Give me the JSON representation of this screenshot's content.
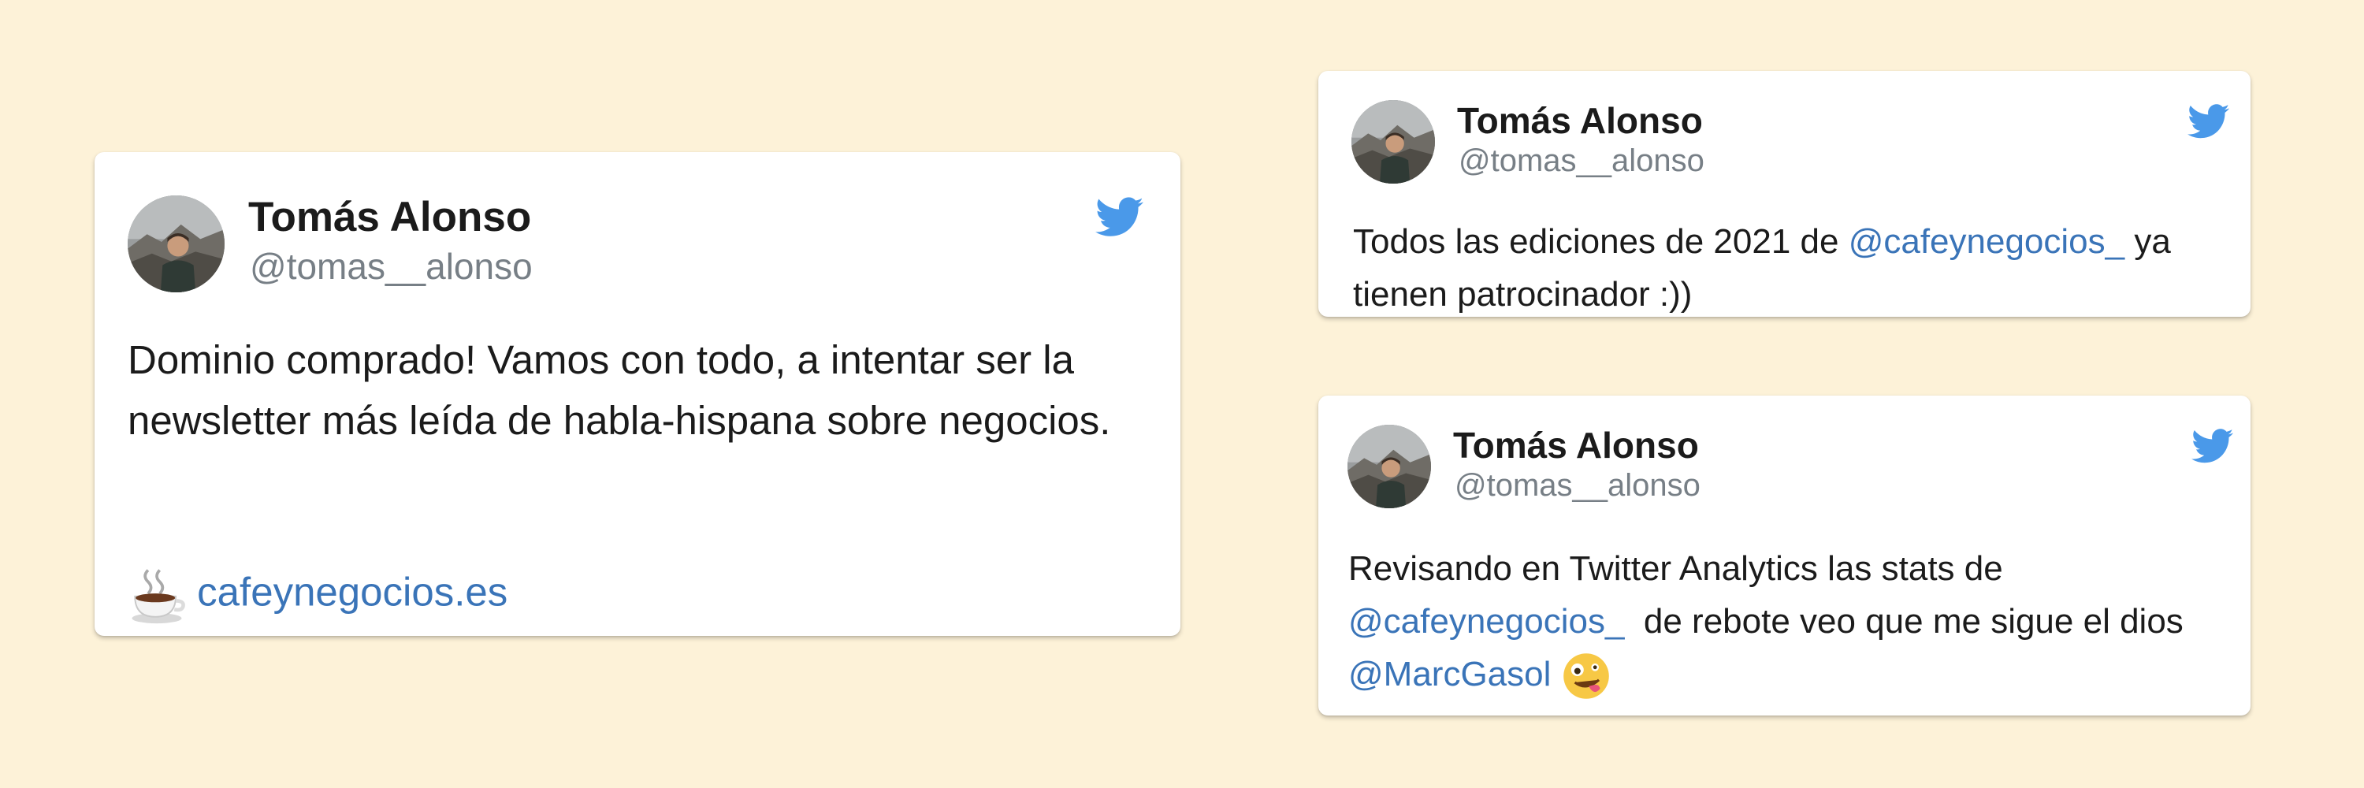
{
  "colors": {
    "background": "#fdf2d8",
    "card": "#ffffff",
    "name_text": "#1b1b1b",
    "handle_text": "#777f86",
    "link": "#3a74b8",
    "twitter_bird": "#4a99e9"
  },
  "icons": {
    "brand": "twitter-bird-icon",
    "avatar": "user-avatar-photo",
    "coffee": "hot-beverage-emoji",
    "face": "zany-face-emoji"
  },
  "tweets": [
    {
      "author_name": "Tomás Alonso",
      "author_handle": "@tomas__alonso",
      "text": "Dominio comprado! Vamos con todo, a intentar ser la newsletter más leída de habla-hispana sobre negocios.",
      "link_text": "cafeynegocios.es"
    },
    {
      "author_name": "Tomás Alonso",
      "author_handle": "@tomas__alonso",
      "text_before": "Todos las ediciones de 2021 de ",
      "mention": "@cafeynegocios_",
      "text_after": " ya tienen patrocinador :))"
    },
    {
      "author_name": "Tomás Alonso",
      "author_handle": "@tomas__alonso",
      "text_before": "Revisando en Twitter Analytics las stats de ",
      "mention_1": "@cafeynegocios_",
      "text_middle": "  de rebote veo que me sigue el dios ",
      "mention_2": "@MarcGasol"
    }
  ]
}
